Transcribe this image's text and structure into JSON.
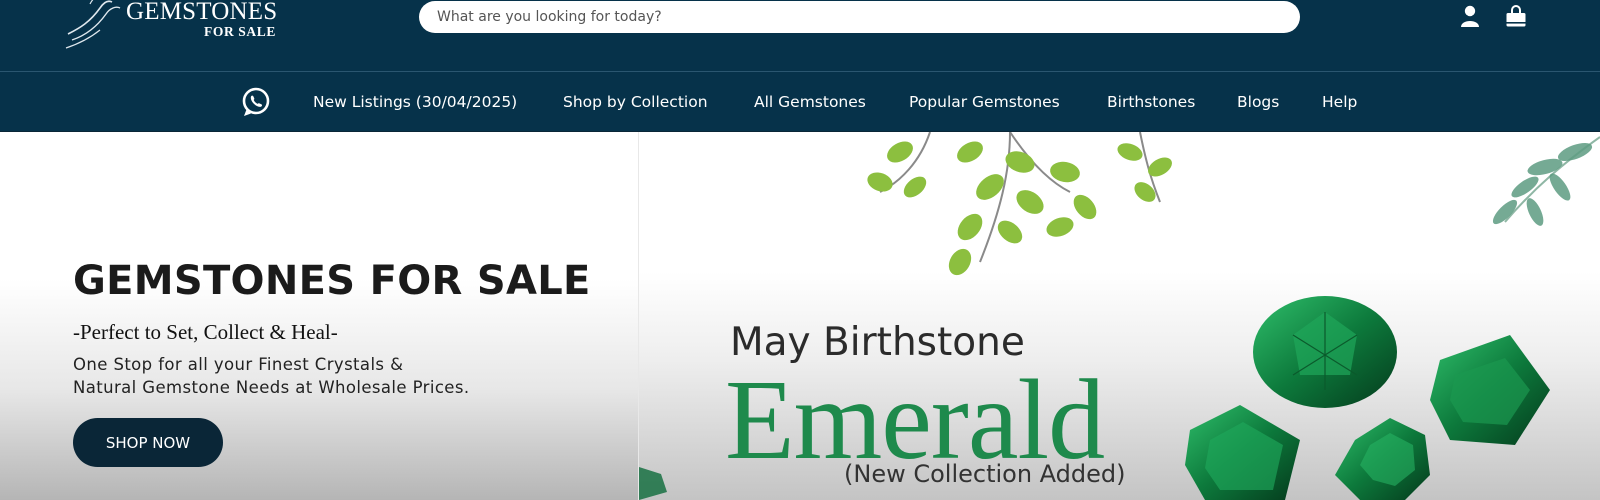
{
  "header": {
    "logo_title": "GEMSTONES",
    "logo_sub": "FOR SALE",
    "search_placeholder": "What are you looking for today?",
    "icons": [
      "user-icon",
      "shopping-bag-icon"
    ],
    "bg_color": "#06324a"
  },
  "nav": {
    "icon": "whatsapp-icon",
    "items": [
      "New Listings (30/04/2025)",
      "Shop by Collection",
      "All Gemstones",
      "Popular Gemstones",
      "Birthstones",
      "Blogs",
      "Help"
    ]
  },
  "hero": {
    "title": "GEMSTONES FOR SALE",
    "tagline": "-Perfect to Set, Collect & Heal-",
    "desc_line1": "One Stop for all your Finest Crystals &",
    "desc_line2": "Natural Gemstone Needs at Wholesale Prices.",
    "button": "SHOP NOW"
  },
  "banner": {
    "line1": "May Birthstone",
    "line2": "Emerald",
    "line3": "(New Collection Added)",
    "accent_color": "#1e8a4c",
    "images": [
      "leaf-branch-illustration",
      "emerald-gemstones-image"
    ]
  }
}
